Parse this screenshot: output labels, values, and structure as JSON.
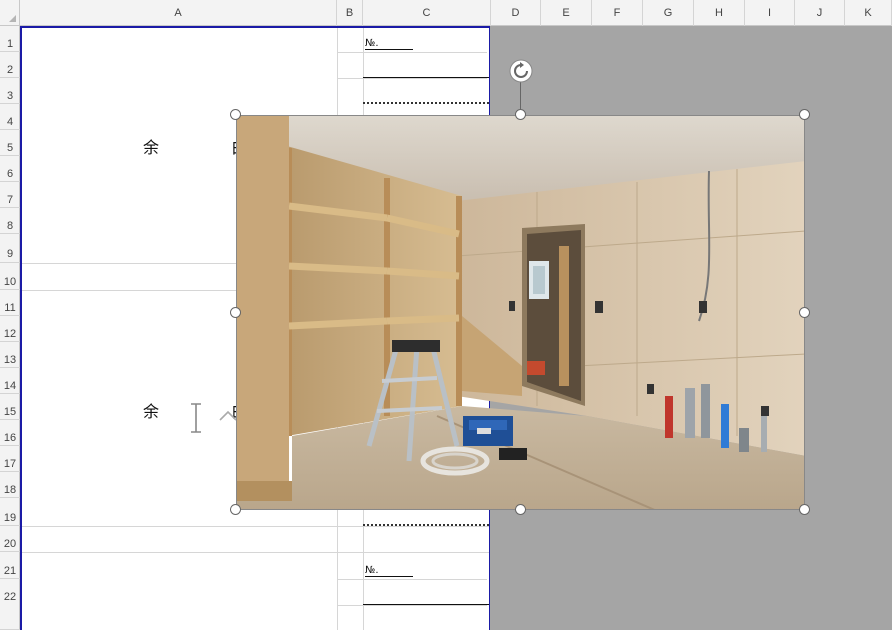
{
  "columns": [
    "A",
    "B",
    "C",
    "D",
    "E",
    "F",
    "G",
    "H",
    "I",
    "J",
    "K"
  ],
  "rows": [
    "1",
    "2",
    "3",
    "4",
    "5",
    "6",
    "7",
    "8",
    "9",
    "10",
    "11",
    "12",
    "13",
    "14",
    "15",
    "16",
    "17",
    "18",
    "19",
    "20",
    "21",
    "22"
  ],
  "sheet": {
    "margin_text_top": "余　白",
    "margin_text_bottom": "余　白",
    "no_label_top": "№.",
    "no_label_bottom": "№."
  },
  "picture": {
    "semantic": "construction-interior-photo"
  },
  "icons": {
    "rotate": "rotate-handle-icon",
    "cursor": "text-cursor-icon"
  },
  "colors": {
    "accent_border": "#1a1aa6",
    "outside_print_area": "#a5a5a5"
  }
}
